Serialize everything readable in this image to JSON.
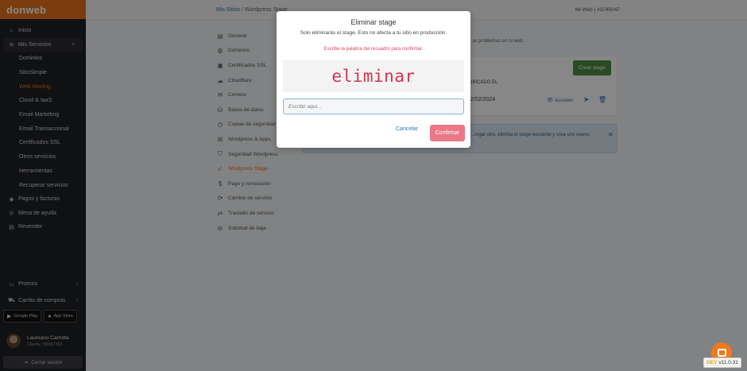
{
  "sidebar": {
    "brand": "donweb",
    "items_top": [
      {
        "label": "Inicio",
        "icon": "home-icon"
      }
    ],
    "group": {
      "label": "Mis Servicios",
      "icon": "servers-icon",
      "chevron": "˄"
    },
    "sub_items": [
      {
        "label": "Dominios"
      },
      {
        "label": "SitioSimple"
      },
      {
        "label": "Web Hosting",
        "active": true
      },
      {
        "label": "Cloud & IaaS"
      },
      {
        "label": "Email Marketing"
      },
      {
        "label": "Email Transaccional"
      },
      {
        "label": "Certificados SSL"
      },
      {
        "label": "Otros servicios"
      },
      {
        "label": "Herramientas"
      },
      {
        "label": "Recuperar servicios"
      }
    ],
    "items_bottom": [
      {
        "label": "Pagos y facturas",
        "icon": "payments-icon"
      },
      {
        "label": "Mesa de ayuda",
        "icon": "help-icon"
      },
      {
        "label": "Revender",
        "icon": "reseller-icon"
      }
    ],
    "promos": "Promos",
    "cart": "Carrito de compras",
    "google_play": "Google Play",
    "app_store": "App Store",
    "user_name": "Laureano Carrotta",
    "user_client": "Cliente: 50567263",
    "logout": "Cerrar sesión"
  },
  "topbar": {
    "crumb_link": "Mis Sitios",
    "crumb_sep": "/",
    "crumb_current": "Wordpress Stage",
    "right": "Mi Web | #3745047"
  },
  "secondary_menu": [
    {
      "label": "General",
      "icon": "document-icon"
    },
    {
      "label": "Dominios",
      "icon": "globe-icon"
    },
    {
      "label": "Certificados SSL",
      "icon": "certificate-icon"
    },
    {
      "label": "Cloudflare",
      "icon": "cloud-icon"
    },
    {
      "label": "Correos",
      "icon": "mail-icon"
    },
    {
      "label": "Bases de datos",
      "icon": "database-icon"
    },
    {
      "label": "Copias de seguridad",
      "icon": "backup-icon"
    },
    {
      "label": "Wordpress & Apps",
      "icon": "apps-icon"
    },
    {
      "label": "Seguridad Wordpress",
      "icon": "shield-icon"
    },
    {
      "label": "Wordpress Stage",
      "icon": "rocket-icon",
      "active": true
    },
    {
      "label": "Pago y renovación",
      "icon": "dollar-icon"
    },
    {
      "label": "Cambio de servicio",
      "icon": "refresh-icon"
    },
    {
      "label": "Traslado de servicio",
      "icon": "transfer-icon"
    },
    {
      "label": "Solicitud de baja",
      "icon": "cancel-icon"
    }
  ],
  "main": {
    "note": "...ar problemas en tu web.",
    "create_button": "Crear stage",
    "col_label": "UBICADO EL",
    "row_date": "2/02/2024",
    "access": "Acceder",
    "info": "...rogar otro, elimina el stage existente y crea uno nuevo."
  },
  "modal": {
    "title": "Eliminar stage",
    "subtitle": "Solo eliminarás el stage. Esto no afecta a tu sitio en producción.",
    "warning": "Escribe la palabra del recuadro para confirmar.",
    "word": "eliminar",
    "input_placeholder": "Escribir aquí...",
    "input_value": "",
    "cancel": "Cancelar",
    "confirm": "Confirmar"
  },
  "footer": {
    "version_tag": "DEV",
    "version": "v11.0.31"
  },
  "colors": {
    "brand": "#e8731c",
    "sidebar_bg": "#1f2023",
    "link": "#2d73c4",
    "danger": "#d6344a",
    "confirm_disabled": "#ec7788",
    "create_green": "#4e8f43"
  }
}
